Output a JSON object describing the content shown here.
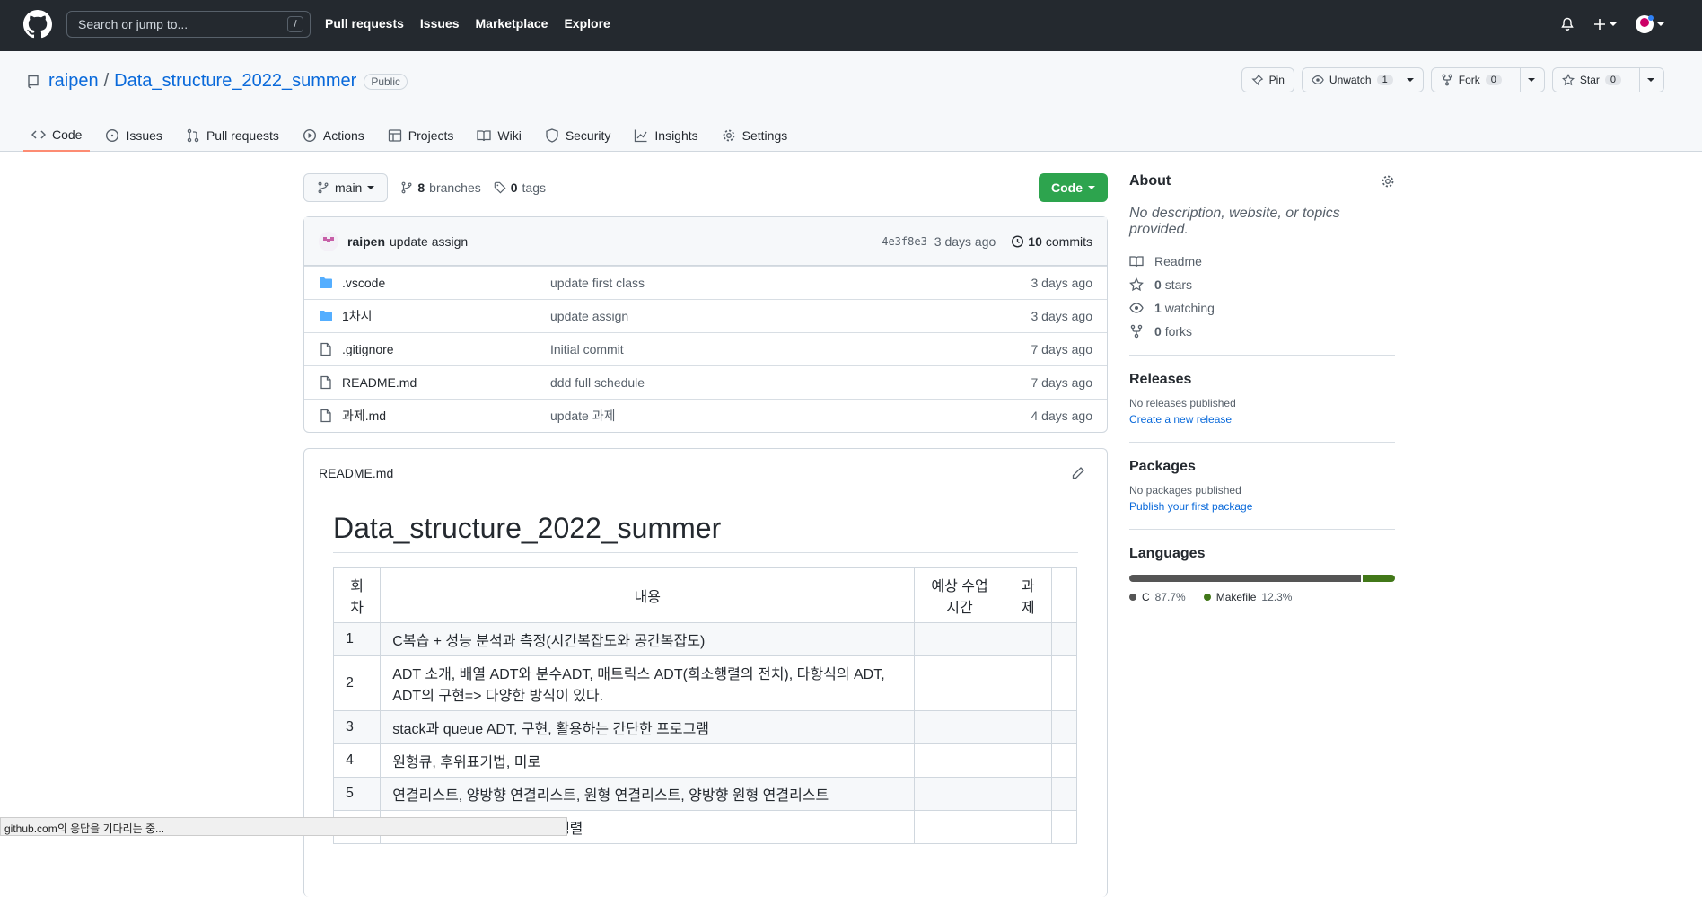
{
  "topbar": {
    "search_placeholder": "Search or jump to...",
    "slash": "/",
    "nav": [
      "Pull requests",
      "Issues",
      "Marketplace",
      "Explore"
    ]
  },
  "repo": {
    "owner": "raipen",
    "sep": "/",
    "name": "Data_structure_2022_summer",
    "visibility": "Public"
  },
  "actions": {
    "pin": "Pin",
    "unwatch": "Unwatch",
    "unwatch_count": "1",
    "fork": "Fork",
    "fork_count": "0",
    "star": "Star",
    "star_count": "0"
  },
  "tabs": [
    "Code",
    "Issues",
    "Pull requests",
    "Actions",
    "Projects",
    "Wiki",
    "Security",
    "Insights",
    "Settings"
  ],
  "branch": {
    "name": "main",
    "branches_count": "8",
    "branches_label": "branches",
    "tags_count": "0",
    "tags_label": "tags",
    "code_button": "Code"
  },
  "commit": {
    "author": "raipen",
    "message": "update assign",
    "sha": "4e3f8e3",
    "age": "3 days ago",
    "count": "10",
    "count_label": "commits"
  },
  "files": [
    {
      "name": ".vscode",
      "type": "folder",
      "msg": "update first class",
      "age": "3 days ago"
    },
    {
      "name": "1차시",
      "type": "folder",
      "msg": "update assign",
      "age": "3 days ago"
    },
    {
      "name": ".gitignore",
      "type": "file",
      "msg": "Initial commit",
      "age": "7 days ago"
    },
    {
      "name": "README.md",
      "type": "file",
      "msg": "ddd full schedule",
      "age": "7 days ago"
    },
    {
      "name": "과제.md",
      "type": "file",
      "msg": "update 과제",
      "age": "4 days ago"
    }
  ],
  "readme": {
    "filename": "README.md",
    "title": "Data_structure_2022_summer",
    "headers": [
      "회\n차",
      "내용",
      "예상 수업\n시간",
      "과\n제",
      ""
    ],
    "rows": [
      {
        "n": "1",
        "content": "C복습 + 성능 분석과 측정(시간복잡도와 공간복잡도)"
      },
      {
        "n": "2",
        "content": "ADT 소개, 배열 ADT와 분수ADT, 매트릭스 ADT(희소행렬의 전치), 다항식의 ADT, ADT의 구현=> 다양한 방식이 있다."
      },
      {
        "n": "3",
        "content": "stack과 queue ADT, 구현, 활용하는 간단한 프로그램"
      },
      {
        "n": "4",
        "content": "원형큐, 후위표기법, 미로"
      },
      {
        "n": "5",
        "content": "연결리스트, 양방향 연결리스트, 원형 연결리스트, 양방향 원형 연결리스트"
      },
      {
        "n": "6",
        "content": "...하기, 동치류 구하기, 희소행렬"
      }
    ]
  },
  "about": {
    "title": "About",
    "description": "No description, website, or topics provided.",
    "readme": "Readme",
    "stars": "0",
    "stars_label": "stars",
    "watching": "1",
    "watching_label": "watching",
    "forks": "0",
    "forks_label": "forks"
  },
  "releases": {
    "title": "Releases",
    "none": "No releases published",
    "link": "Create a new release"
  },
  "packages": {
    "title": "Packages",
    "none": "No packages published",
    "link": "Publish your first package"
  },
  "languages": {
    "title": "Languages",
    "items": [
      {
        "name": "C",
        "pct": "87.7%",
        "value": 87.7,
        "color": "#555555"
      },
      {
        "name": "Makefile",
        "pct": "12.3%",
        "value": 12.3,
        "color": "#427819"
      }
    ]
  },
  "status_text": "github.com의 응답을 기다리는 중..."
}
